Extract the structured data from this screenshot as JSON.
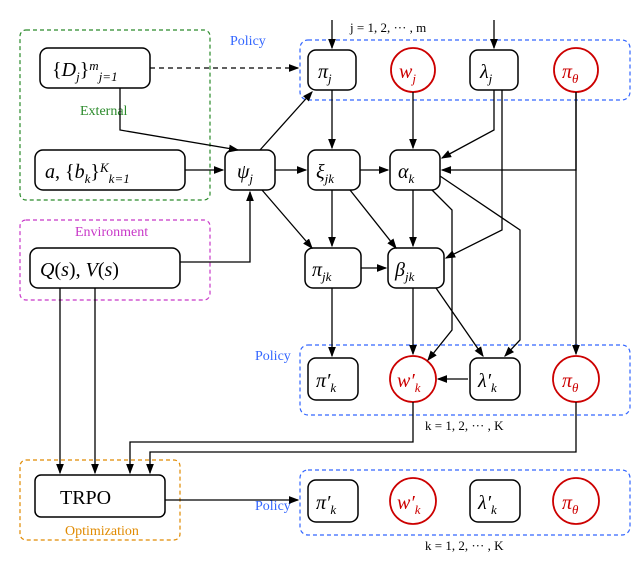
{
  "groups": {
    "external": {
      "label": "External",
      "color": "#2a8a2a"
    },
    "environment": {
      "label": "Environment",
      "color": "#c838c8"
    },
    "optimization": {
      "label": "Optimization",
      "color": "#e08a00"
    },
    "policy": {
      "label": "Policy",
      "color": "#3366ff"
    }
  },
  "annotations": {
    "top_j": "j = 1, 2, ··· , m",
    "mid_k": "k = 1, 2, ··· , K",
    "bot_k": "k = 1, 2, ··· , K"
  },
  "nodes": {
    "D": "{Dⱼ}ⱼ₌₁ᵐ",
    "ab": "a, {bₖ}ₖ₌₁ᴷ",
    "QV": "Q(s), V(s)",
    "TRPO": "TRPO",
    "psi": "ψⱼ",
    "pij": "πⱼ",
    "xi": "ξⱼₖ",
    "pijk": "πⱼₖ",
    "alpha": "αₖ",
    "beta": "βⱼₖ",
    "wj": "wⱼ",
    "lambdaj": "λⱼ",
    "pitheta": "π_θ",
    "pik_prime": "π′ₖ",
    "wk_prime": "w′ₖ",
    "lambdak_prime": "λ′ₖ",
    "pik_prime2": "π′ₖ",
    "wk_prime2": "w′ₖ",
    "lambdak_prime2": "λ′ₖ"
  }
}
